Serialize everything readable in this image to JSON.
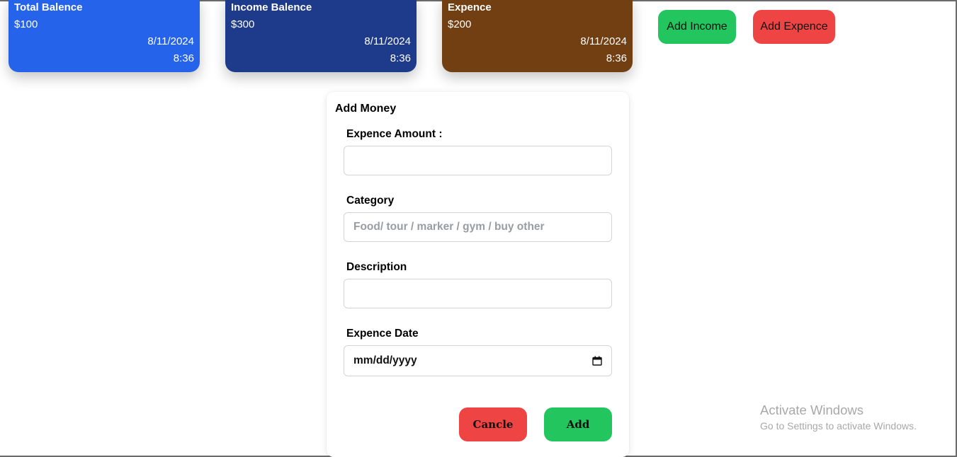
{
  "cards": [
    {
      "title": "Total Balence",
      "amount": "$100",
      "date": "8/11/2024",
      "time": "8:36",
      "color": "#2563eb"
    },
    {
      "title": "Income Balence",
      "amount": "$300",
      "date": "8/11/2024",
      "time": "8:36",
      "color": "#1e3a8a"
    },
    {
      "title": "Expence",
      "amount": "$200",
      "date": "8/11/2024",
      "time": "8:36",
      "color": "#713f12"
    }
  ],
  "actions": {
    "add_income": "Add Income",
    "add_income_color": "#22c55e",
    "add_expence": "Add Expence",
    "add_expence_color": "#ef4444"
  },
  "modal": {
    "title": "Add Money",
    "amount_label": "Expence Amount :",
    "amount_value": "",
    "category_label": "Category",
    "category_placeholder": "Food/ tour / marker / gym / buy other",
    "description_label": "Description",
    "description_value": "",
    "date_label": "Expence Date",
    "date_placeholder": "mm/dd/yyyy",
    "date_icon": "calendar-icon",
    "cancel_label": "Cancle",
    "add_label": "Add"
  },
  "watermark": {
    "title": "Activate Windows",
    "subtitle": "Go to Settings to activate Windows."
  }
}
